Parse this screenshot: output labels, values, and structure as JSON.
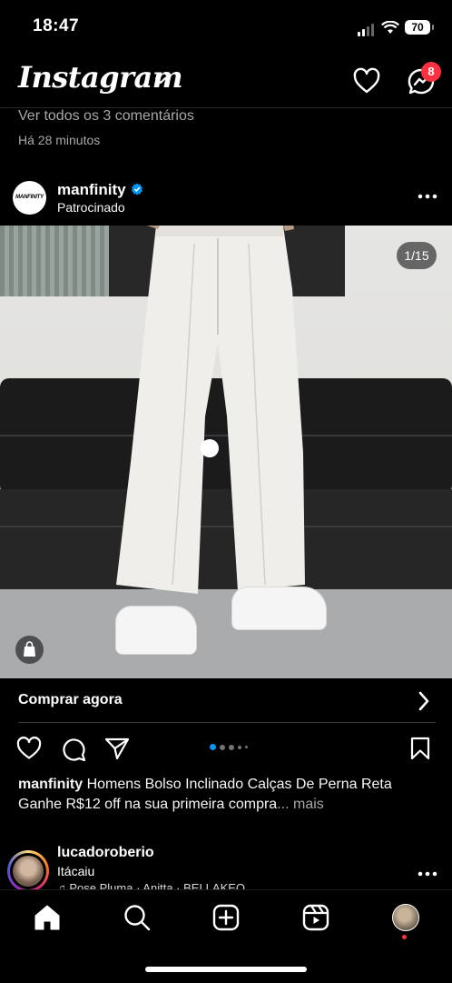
{
  "status_bar": {
    "time": "18:47",
    "battery": "70"
  },
  "header": {
    "logo": "Instagram",
    "notifications_badge": "8"
  },
  "previous_post": {
    "view_comments": "Ver todos os 3 comentários",
    "time": "Há 28 minutos"
  },
  "post": {
    "avatar_text": "MANFINITY",
    "username": "manfinity",
    "sponsored_label": "Patrocinado",
    "image_counter": "1/15",
    "cta": "Comprar agora",
    "caption_user": "manfinity",
    "caption_text": "Homens Bolso Inclinado Calças De Perna Reta Ganhe R$12 off na sua primeira compra",
    "caption_more": "... mais",
    "carousel_active_index": 0
  },
  "next_post": {
    "username": "lucadoroberio",
    "location": "Itácaiu",
    "music": "Pose Pluma · Anitta · BELLAKEO"
  },
  "icons": {
    "header": [
      "chevron-down-icon",
      "heart-icon",
      "messenger-icon"
    ],
    "post": [
      "verified-icon",
      "more-icon",
      "shopping-bag-icon",
      "chevron-right-icon",
      "heart-icon",
      "comment-icon",
      "share-icon",
      "bookmark-icon"
    ],
    "nav": [
      "home-icon",
      "search-icon",
      "create-icon",
      "reels-icon",
      "profile-avatar"
    ]
  },
  "colors": {
    "background": "#000000",
    "badge": "#ff3040",
    "verified": "#0095f6",
    "carousel_active": "#0095f6"
  }
}
